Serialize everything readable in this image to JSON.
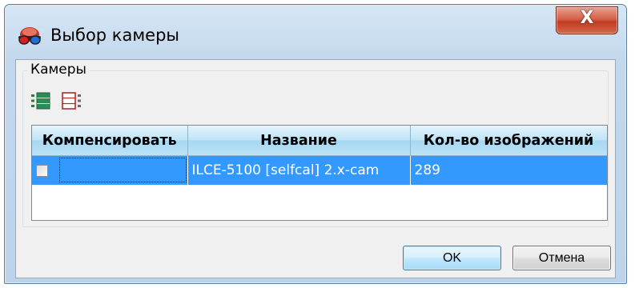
{
  "window": {
    "title": "Выбор камеры",
    "close_symbol": "X",
    "icon": "red-blue-glasses-icon"
  },
  "cameras_group": {
    "label": "Камеры",
    "toolbar_icons": [
      "select-all-icon",
      "deselect-all-icon"
    ]
  },
  "table": {
    "columns": [
      "Компенсировать",
      "Название",
      "Кол-во изображений"
    ],
    "rows": [
      {
        "compensate": false,
        "name": "ILCE-5100 [selfcal] 2.x-cam",
        "image_count": "289",
        "selected": true
      }
    ]
  },
  "buttons": {
    "ok": "OK",
    "cancel": "Отмена"
  },
  "colors": {
    "selection": "#3399ff",
    "header": "#bfe4f7"
  }
}
